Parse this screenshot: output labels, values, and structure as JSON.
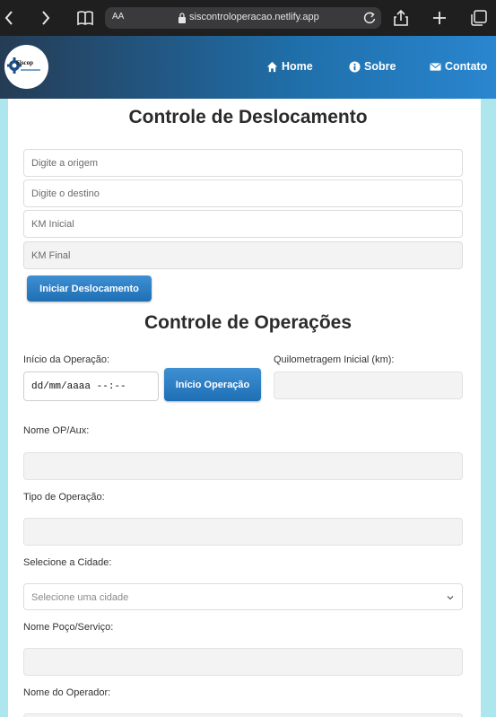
{
  "browser": {
    "aa_label": "AA",
    "url": "siscontroloperacao.netlify.app"
  },
  "header": {
    "logo_text": "Siscop",
    "nav": [
      {
        "label": "Home",
        "icon": "home-icon"
      },
      {
        "label": "Sobre",
        "icon": "info-icon"
      },
      {
        "label": "Contato",
        "icon": "envelope-icon"
      }
    ]
  },
  "deslocamento": {
    "title": "Controle de Deslocamento",
    "origem_placeholder": "Digite a origem",
    "destino_placeholder": "Digite o destino",
    "km_inicial_placeholder": "KM Inicial",
    "km_final_placeholder": "KM Final",
    "iniciar_button": "Iniciar Deslocamento"
  },
  "operacoes": {
    "title": "Controle de Operações",
    "inicio_label": "Início da Operação:",
    "date_placeholder": "dd/mm/aaaa --:--",
    "inicio_button": "Início Operação",
    "quilometragem_label": "Quilometragem Inicial (km):",
    "nome_op_label": "Nome OP/Aux:",
    "tipo_label": "Tipo de Operação:",
    "cidade_label": "Selecione a Cidade:",
    "cidade_placeholder": "Selecione uma cidade",
    "poco_label": "Nome Poço/Serviço:",
    "operador_label": "Nome do Operador:"
  },
  "colors": {
    "header_start": "#253c55",
    "header_end": "#2a86cf",
    "button": "#1f6fb5",
    "background": "#aee6ee"
  }
}
